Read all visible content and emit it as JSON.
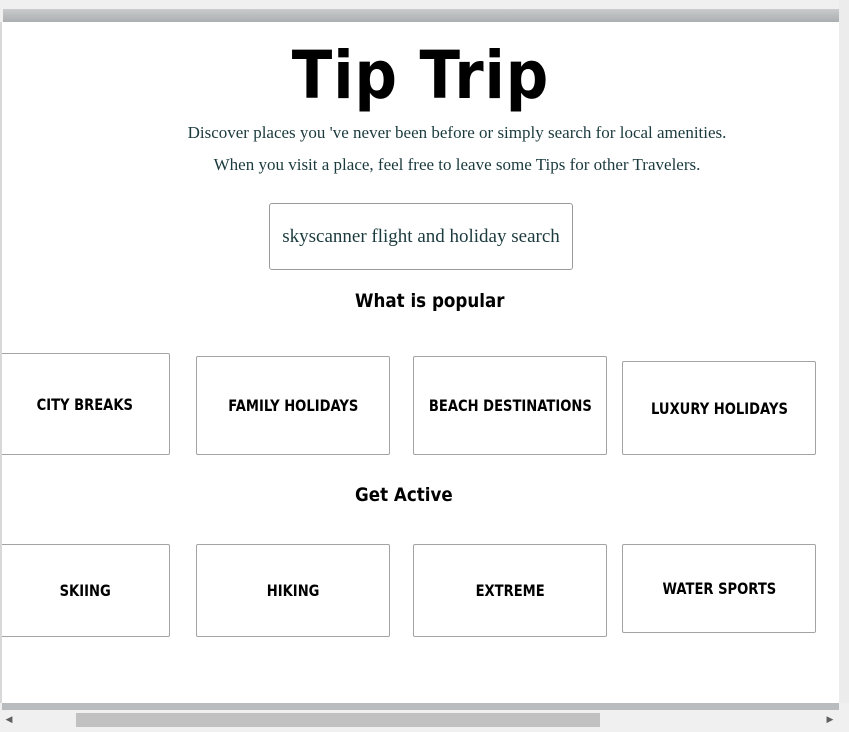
{
  "header": {
    "title": "Tip Trip",
    "intro_line1": "Discover places you 've never been before or simply search for local amenities.",
    "intro_line2": "When you visit a place, feel free to leave some Tips for other Travelers."
  },
  "search": {
    "value": "skyscanner flight and holiday search"
  },
  "popular": {
    "heading": "What is popular",
    "items": [
      {
        "label": "CITY BREAKS"
      },
      {
        "label": "FAMILY HOLIDAYS"
      },
      {
        "label": "BEACH DESTINATIONS"
      },
      {
        "label": "LUXURY HOLIDAYS"
      }
    ]
  },
  "active": {
    "heading": "Get Active",
    "items": [
      {
        "label": "SKIING"
      },
      {
        "label": "HIKING"
      },
      {
        "label": "EXTREME"
      },
      {
        "label": "WATER SPORTS"
      }
    ]
  },
  "scrollbar": {
    "left_icon": "arrow-left-icon",
    "right_icon": "arrow-right-icon"
  },
  "colors": {
    "text_teal": "#1b3a3d",
    "card_border": "#a3a3a3"
  }
}
